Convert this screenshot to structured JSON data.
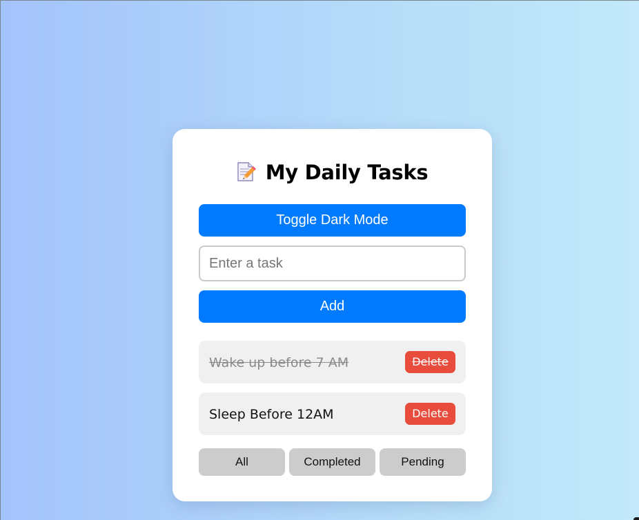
{
  "app": {
    "title": "My Daily Tasks",
    "title_icon": "memo-icon"
  },
  "controls": {
    "toggle_label": "Toggle Dark Mode",
    "input_placeholder": "Enter a task",
    "input_value": "",
    "add_label": "Add"
  },
  "tasks": [
    {
      "text": "Wake up before 7 AM",
      "completed": true,
      "delete_label": "Delete"
    },
    {
      "text": "Sleep Before 12AM",
      "completed": false,
      "delete_label": "Delete"
    }
  ],
  "filters": [
    {
      "label": "All"
    },
    {
      "label": "Completed"
    },
    {
      "label": "Pending"
    }
  ],
  "colors": {
    "primary": "#007bff",
    "danger": "#e74c3c",
    "filter_bg": "#cccccc",
    "task_bg": "#f0f0f0"
  }
}
